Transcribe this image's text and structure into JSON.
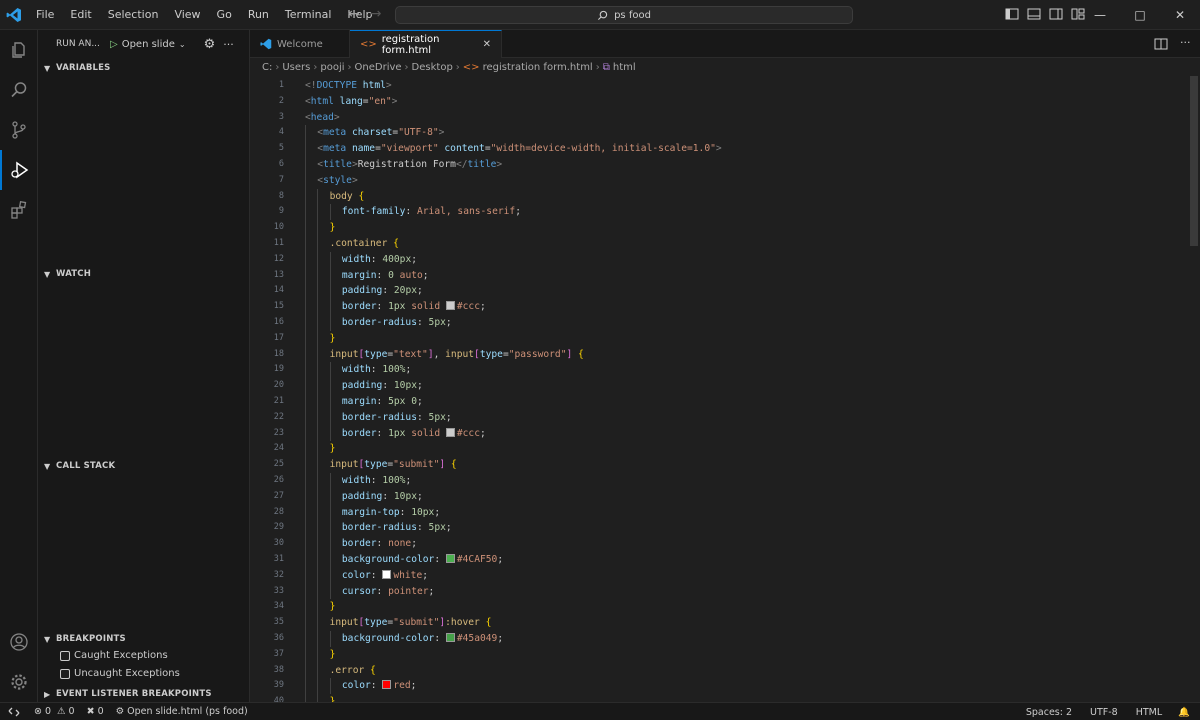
{
  "menu": [
    "File",
    "Edit",
    "Selection",
    "View",
    "Go",
    "Run",
    "Terminal",
    "Help"
  ],
  "search": {
    "text": "ps food"
  },
  "sidebar": {
    "run_title": "RUN AN...",
    "run_config": "Open slide",
    "sections": {
      "variables": "VARIABLES",
      "watch": "WATCH",
      "callstack": "CALL STACK",
      "breakpoints": "BREAKPOINTS",
      "event": "EVENT LISTENER BREAKPOINTS"
    },
    "breakpoints": [
      "Caught Exceptions",
      "Uncaught Exceptions"
    ]
  },
  "tabs": [
    {
      "label": "Welcome",
      "active": false
    },
    {
      "label": "registration form.html",
      "active": true
    }
  ],
  "breadcrumb": [
    "C:",
    "Users",
    "pooji",
    "OneDrive",
    "Desktop",
    "registration form.html",
    "html"
  ],
  "editor": {
    "lines": [
      {
        "n": "1",
        "indent": 0,
        "parts": [
          [
            "c-tag",
            "<!"
          ],
          [
            "c-name",
            "DOCTYPE"
          ],
          [
            "c-attr",
            " html"
          ],
          [
            "c-tag",
            ">"
          ]
        ]
      },
      {
        "n": "2",
        "indent": 0,
        "parts": [
          [
            "c-tag",
            "<"
          ],
          [
            "c-name",
            "html"
          ],
          [
            "c-attr",
            " lang"
          ],
          [
            "c-text",
            "="
          ],
          [
            "c-str",
            "\"en\""
          ],
          [
            "c-tag",
            ">"
          ]
        ]
      },
      {
        "n": "3",
        "indent": 0,
        "parts": [
          [
            "c-tag",
            "<"
          ],
          [
            "c-name",
            "head"
          ],
          [
            "c-tag",
            ">"
          ]
        ]
      },
      {
        "n": "4",
        "indent": 1,
        "parts": [
          [
            "c-tag",
            "<"
          ],
          [
            "c-name",
            "meta"
          ],
          [
            "c-attr",
            " charset"
          ],
          [
            "c-text",
            "="
          ],
          [
            "c-str",
            "\"UTF-8\""
          ],
          [
            "c-tag",
            ">"
          ]
        ]
      },
      {
        "n": "5",
        "indent": 1,
        "parts": [
          [
            "c-tag",
            "<"
          ],
          [
            "c-name",
            "meta"
          ],
          [
            "c-attr",
            " name"
          ],
          [
            "c-text",
            "="
          ],
          [
            "c-str",
            "\"viewport\""
          ],
          [
            "c-attr",
            " content"
          ],
          [
            "c-text",
            "="
          ],
          [
            "c-str",
            "\"width=device-width, initial-scale=1.0\""
          ],
          [
            "c-tag",
            ">"
          ]
        ]
      },
      {
        "n": "6",
        "indent": 1,
        "parts": [
          [
            "c-tag",
            "<"
          ],
          [
            "c-name",
            "title"
          ],
          [
            "c-tag",
            ">"
          ],
          [
            "c-text",
            "Registration Form"
          ],
          [
            "c-tag",
            "</"
          ],
          [
            "c-name",
            "title"
          ],
          [
            "c-tag",
            ">"
          ]
        ]
      },
      {
        "n": "7",
        "indent": 1,
        "parts": [
          [
            "c-tag",
            "<"
          ],
          [
            "c-name",
            "style"
          ],
          [
            "c-tag",
            ">"
          ]
        ]
      },
      {
        "n": "8",
        "indent": 2,
        "parts": [
          [
            "c-sel",
            "body"
          ],
          [
            "c-br",
            " {"
          ]
        ]
      },
      {
        "n": "9",
        "indent": 3,
        "parts": [
          [
            "c-prop",
            "font-family"
          ],
          [
            "c-text",
            ": "
          ],
          [
            "c-val",
            "Arial, sans-serif"
          ],
          [
            "c-text",
            ";"
          ]
        ]
      },
      {
        "n": "10",
        "indent": 2,
        "parts": [
          [
            "c-br",
            "}"
          ]
        ]
      },
      {
        "n": "11",
        "indent": 2,
        "parts": [
          [
            "c-sel",
            ".container"
          ],
          [
            "c-br",
            " {"
          ]
        ]
      },
      {
        "n": "12",
        "indent": 3,
        "parts": [
          [
            "c-prop",
            "width"
          ],
          [
            "c-text",
            ": "
          ],
          [
            "c-num",
            "400px"
          ],
          [
            "c-text",
            ";"
          ]
        ]
      },
      {
        "n": "13",
        "indent": 3,
        "parts": [
          [
            "c-prop",
            "margin"
          ],
          [
            "c-text",
            ": "
          ],
          [
            "c-num",
            "0"
          ],
          [
            "c-val",
            " auto"
          ],
          [
            "c-text",
            ";"
          ]
        ]
      },
      {
        "n": "14",
        "indent": 3,
        "parts": [
          [
            "c-prop",
            "padding"
          ],
          [
            "c-text",
            ": "
          ],
          [
            "c-num",
            "20px"
          ],
          [
            "c-text",
            ";"
          ]
        ]
      },
      {
        "n": "15",
        "indent": 3,
        "parts": [
          [
            "c-prop",
            "border"
          ],
          [
            "c-text",
            ": "
          ],
          [
            "c-num",
            "1px"
          ],
          [
            "c-val",
            " solid "
          ],
          [
            "swatch",
            "#cccccc"
          ],
          [
            "c-val",
            "#ccc"
          ],
          [
            "c-text",
            ";"
          ]
        ]
      },
      {
        "n": "16",
        "indent": 3,
        "parts": [
          [
            "c-prop",
            "border-radius"
          ],
          [
            "c-text",
            ": "
          ],
          [
            "c-num",
            "5px"
          ],
          [
            "c-text",
            ";"
          ]
        ]
      },
      {
        "n": "17",
        "indent": 2,
        "parts": [
          [
            "c-br",
            "}"
          ]
        ]
      },
      {
        "n": "18",
        "indent": 2,
        "parts": [
          [
            "c-sel",
            "input"
          ],
          [
            "c-br2",
            "["
          ],
          [
            "c-attr",
            "type"
          ],
          [
            "c-text",
            "="
          ],
          [
            "c-str",
            "\"text\""
          ],
          [
            "c-br2",
            "]"
          ],
          [
            "c-text",
            ", "
          ],
          [
            "c-sel",
            "input"
          ],
          [
            "c-br2",
            "["
          ],
          [
            "c-attr",
            "type"
          ],
          [
            "c-text",
            "="
          ],
          [
            "c-str",
            "\"password\""
          ],
          [
            "c-br2",
            "]"
          ],
          [
            "c-br",
            " {"
          ]
        ]
      },
      {
        "n": "19",
        "indent": 3,
        "parts": [
          [
            "c-prop",
            "width"
          ],
          [
            "c-text",
            ": "
          ],
          [
            "c-num",
            "100%"
          ],
          [
            "c-text",
            ";"
          ]
        ]
      },
      {
        "n": "20",
        "indent": 3,
        "parts": [
          [
            "c-prop",
            "padding"
          ],
          [
            "c-text",
            ": "
          ],
          [
            "c-num",
            "10px"
          ],
          [
            "c-text",
            ";"
          ]
        ]
      },
      {
        "n": "21",
        "indent": 3,
        "parts": [
          [
            "c-prop",
            "margin"
          ],
          [
            "c-text",
            ": "
          ],
          [
            "c-num",
            "5px 0"
          ],
          [
            "c-text",
            ";"
          ]
        ]
      },
      {
        "n": "22",
        "indent": 3,
        "parts": [
          [
            "c-prop",
            "border-radius"
          ],
          [
            "c-text",
            ": "
          ],
          [
            "c-num",
            "5px"
          ],
          [
            "c-text",
            ";"
          ]
        ]
      },
      {
        "n": "23",
        "indent": 3,
        "parts": [
          [
            "c-prop",
            "border"
          ],
          [
            "c-text",
            ": "
          ],
          [
            "c-num",
            "1px"
          ],
          [
            "c-val",
            " solid "
          ],
          [
            "swatch",
            "#cccccc"
          ],
          [
            "c-val",
            "#ccc"
          ],
          [
            "c-text",
            ";"
          ]
        ]
      },
      {
        "n": "24",
        "indent": 2,
        "parts": [
          [
            "c-br",
            "}"
          ]
        ]
      },
      {
        "n": "25",
        "indent": 2,
        "parts": [
          [
            "c-sel",
            "input"
          ],
          [
            "c-br2",
            "["
          ],
          [
            "c-attr",
            "type"
          ],
          [
            "c-text",
            "="
          ],
          [
            "c-str",
            "\"submit\""
          ],
          [
            "c-br2",
            "]"
          ],
          [
            "c-br",
            " {"
          ]
        ]
      },
      {
        "n": "26",
        "indent": 3,
        "parts": [
          [
            "c-prop",
            "width"
          ],
          [
            "c-text",
            ": "
          ],
          [
            "c-num",
            "100%"
          ],
          [
            "c-text",
            ";"
          ]
        ]
      },
      {
        "n": "27",
        "indent": 3,
        "parts": [
          [
            "c-prop",
            "padding"
          ],
          [
            "c-text",
            ": "
          ],
          [
            "c-num",
            "10px"
          ],
          [
            "c-text",
            ";"
          ]
        ]
      },
      {
        "n": "28",
        "indent": 3,
        "parts": [
          [
            "c-prop",
            "margin-top"
          ],
          [
            "c-text",
            ": "
          ],
          [
            "c-num",
            "10px"
          ],
          [
            "c-text",
            ";"
          ]
        ]
      },
      {
        "n": "29",
        "indent": 3,
        "parts": [
          [
            "c-prop",
            "border-radius"
          ],
          [
            "c-text",
            ": "
          ],
          [
            "c-num",
            "5px"
          ],
          [
            "c-text",
            ";"
          ]
        ]
      },
      {
        "n": "30",
        "indent": 3,
        "parts": [
          [
            "c-prop",
            "border"
          ],
          [
            "c-text",
            ": "
          ],
          [
            "c-val",
            "none"
          ],
          [
            "c-text",
            ";"
          ]
        ]
      },
      {
        "n": "31",
        "indent": 3,
        "parts": [
          [
            "c-prop",
            "background-color"
          ],
          [
            "c-text",
            ": "
          ],
          [
            "swatch",
            "#4caf50"
          ],
          [
            "c-val",
            "#4CAF50"
          ],
          [
            "c-text",
            ";"
          ]
        ]
      },
      {
        "n": "32",
        "indent": 3,
        "parts": [
          [
            "c-prop",
            "color"
          ],
          [
            "c-text",
            ": "
          ],
          [
            "swatch",
            "#ffffff"
          ],
          [
            "c-val",
            "white"
          ],
          [
            "c-text",
            ";"
          ]
        ]
      },
      {
        "n": "33",
        "indent": 3,
        "parts": [
          [
            "c-prop",
            "cursor"
          ],
          [
            "c-text",
            ": "
          ],
          [
            "c-val",
            "pointer"
          ],
          [
            "c-text",
            ";"
          ]
        ]
      },
      {
        "n": "34",
        "indent": 2,
        "parts": [
          [
            "c-br",
            "}"
          ]
        ]
      },
      {
        "n": "35",
        "indent": 2,
        "parts": [
          [
            "c-sel",
            "input"
          ],
          [
            "c-br2",
            "["
          ],
          [
            "c-attr",
            "type"
          ],
          [
            "c-text",
            "="
          ],
          [
            "c-str",
            "\"submit\""
          ],
          [
            "c-br2",
            "]"
          ],
          [
            "c-sel",
            ":hover"
          ],
          [
            "c-br",
            " {"
          ]
        ]
      },
      {
        "n": "36",
        "indent": 3,
        "parts": [
          [
            "c-prop",
            "background-color"
          ],
          [
            "c-text",
            ": "
          ],
          [
            "swatch",
            "#45a049"
          ],
          [
            "c-val",
            "#45a049"
          ],
          [
            "c-text",
            ";"
          ]
        ]
      },
      {
        "n": "37",
        "indent": 2,
        "parts": [
          [
            "c-br",
            "}"
          ]
        ]
      },
      {
        "n": "38",
        "indent": 2,
        "parts": [
          [
            "c-sel",
            ".error"
          ],
          [
            "c-br",
            " {"
          ]
        ]
      },
      {
        "n": "39",
        "indent": 3,
        "parts": [
          [
            "c-prop",
            "color"
          ],
          [
            "c-text",
            ": "
          ],
          [
            "swatch",
            "#ff0000"
          ],
          [
            "c-val",
            "red"
          ],
          [
            "c-text",
            ";"
          ]
        ]
      },
      {
        "n": "40",
        "indent": 2,
        "parts": [
          [
            "c-br",
            "}"
          ]
        ]
      }
    ]
  },
  "status": {
    "errors": "0",
    "warnings": "0",
    "ports": "0",
    "live": "Open slide.html (ps food)",
    "spaces": "Spaces: 2",
    "encoding": "UTF-8",
    "language": "HTML"
  },
  "colors": {
    "accent": "#0078d4",
    "bg": "#1f1f1f",
    "sidebar": "#181818"
  }
}
